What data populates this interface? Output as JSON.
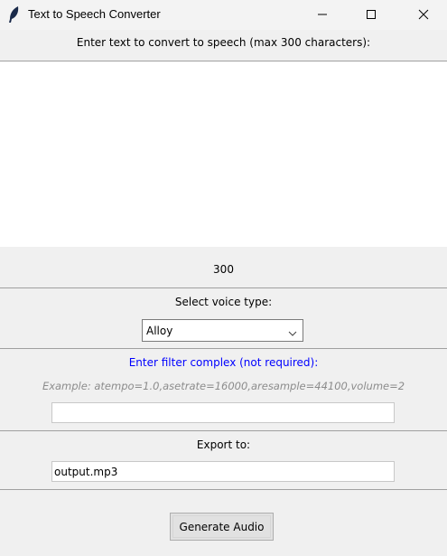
{
  "window": {
    "title": "Text to Speech Converter",
    "icon": "feather-icon"
  },
  "prompt": {
    "label": "Enter text to convert to speech (max 300 characters):",
    "text": ""
  },
  "char_count": "300",
  "voice": {
    "label": "Select voice type:",
    "selected": "Alloy"
  },
  "filter": {
    "label": "Enter filter complex (not required):",
    "example": "Example: atempo=1.0,asetrate=16000,aresample=44100,volume=2",
    "value": "",
    "label_color": "#0000ff"
  },
  "export": {
    "label": "Export to:",
    "value": "output.mp3"
  },
  "generate_button": "Generate Audio"
}
